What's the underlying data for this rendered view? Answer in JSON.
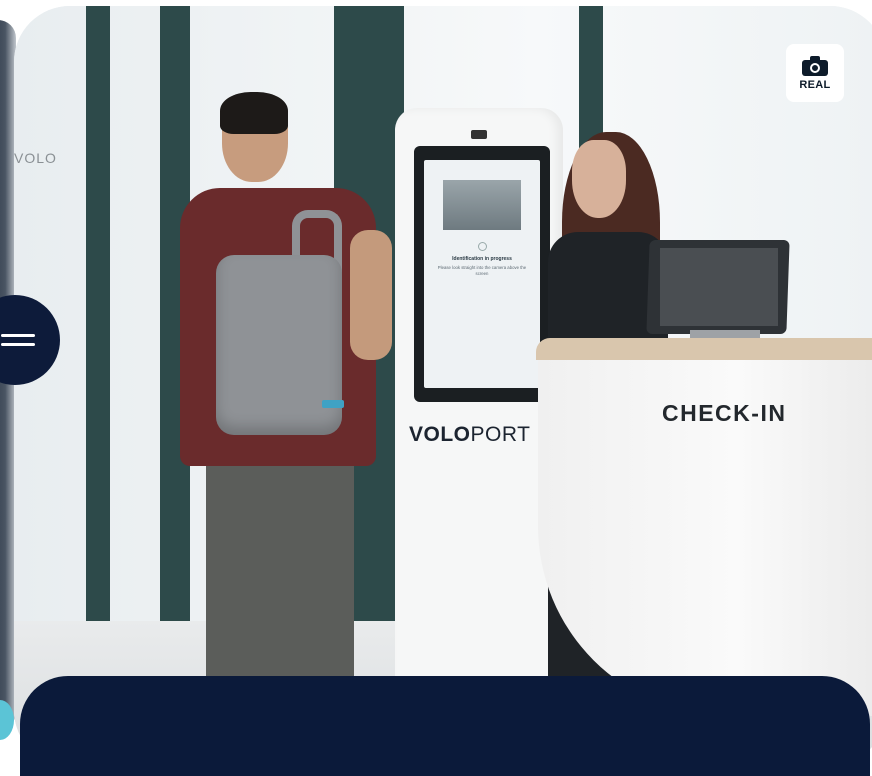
{
  "badge": {
    "label": "REAL",
    "icon": "camera-icon"
  },
  "menu": {
    "icon": "hamburger-icon"
  },
  "photo": {
    "kiosk_brand_a": "VOLO",
    "kiosk_brand_b": "PORT",
    "kiosk_screen_title": "Identification in progress",
    "kiosk_screen_subtitle": "Please look straight into the camera above the screen",
    "counter_label": "CHECK-IN",
    "glass_text": "VOLO"
  },
  "colors": {
    "navy": "#0b1a3a",
    "accent": "#5bc4d6"
  }
}
